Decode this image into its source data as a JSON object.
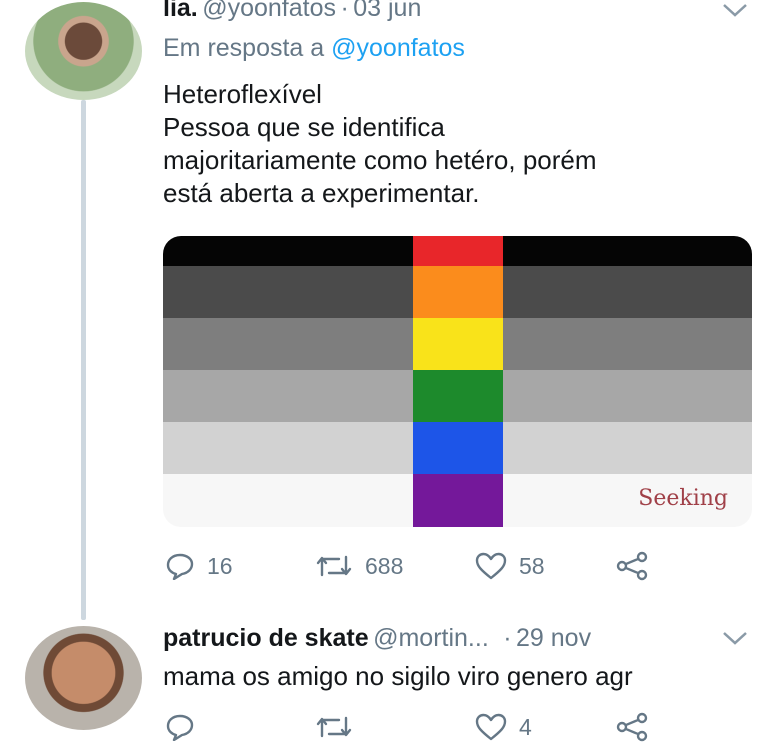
{
  "tweet1": {
    "name": "lia.",
    "handle": "@yoonfatos",
    "sep": "·",
    "date": "03 jun",
    "reply_prefix": "Em resposta a",
    "reply_handle": "@yoonfatos",
    "lines": [
      "Heteroflexível",
      "Pessoa que se identifica",
      "majoritariamente como hetéro, porém",
      "está aberta a experimentar."
    ],
    "image_watermark": "Seeking",
    "actions": {
      "replies": "16",
      "retweets": "688",
      "likes": "58"
    }
  },
  "tweet2": {
    "name": "patrucio de skate",
    "handle": "@mortin...",
    "sep": "·",
    "date": "29 nov",
    "text": "mama os amigo no sigilo viro genero agr",
    "actions": {
      "replies": "",
      "retweets": "",
      "likes": "4"
    }
  },
  "colors": {
    "flag_bands": [
      "#050505",
      "#4b4b4b",
      "#7e7e7e",
      "#a7a7a7",
      "#d2d2d2",
      "#f7f7f7"
    ],
    "rainbow": [
      "#e8262a",
      "#fb8c1c",
      "#f9e31a",
      "#1d8a2c",
      "#1d55e8",
      "#74189a"
    ],
    "link": "#1da1f2",
    "muted": "#657786"
  }
}
